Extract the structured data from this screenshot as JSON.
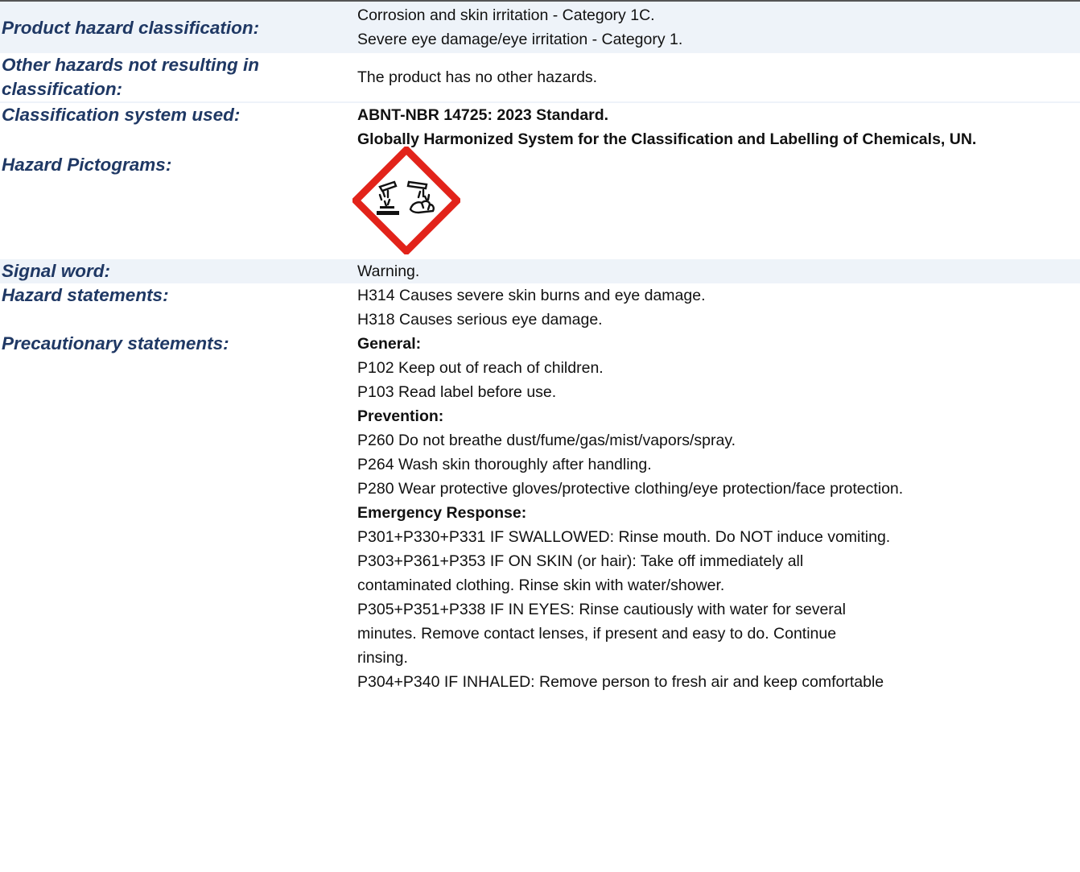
{
  "rows": {
    "product_hazard": {
      "label": "Product hazard classification:",
      "lines": [
        "Corrosion and skin irritation - Category 1C.",
        "Severe eye damage/eye irritation - Category 1."
      ]
    },
    "other_hazards": {
      "label": "Other hazards not resulting in classification:",
      "value": "The product has no other hazards."
    },
    "classification_system": {
      "label": "Classification system used:",
      "line1": "ABNT-NBR 14725: 2023 Standard.",
      "line2": "Globally Harmonized System for the Classification and Labelling of Chemicals, UN."
    },
    "pictograms": {
      "label": "Hazard Pictograms:",
      "icon": "corrosion-pictogram-icon",
      "border_color": "#e2231a"
    },
    "signal_word": {
      "label": "Signal word:",
      "value": "Warning."
    },
    "hazard_statements": {
      "label": "Hazard statements:",
      "lines": [
        "H314 Causes severe skin burns and eye damage.",
        "H318 Causes serious eye damage."
      ]
    },
    "precautionary": {
      "label": "Precautionary statements:",
      "general_heading": "General:",
      "general": [
        "P102 Keep out of reach of children.",
        "P103 Read label before use."
      ],
      "prevention_heading": "Prevention:",
      "prevention": [
        "P260 Do not breathe dust/fume/gas/mist/vapors/spray.",
        "P264 Wash skin thoroughly after handling.",
        "P280 Wear protective gloves/protective clothing/eye protection/face protection."
      ],
      "emergency_heading": "Emergency Response:",
      "emergency": [
        "P301+P330+P331 IF SWALLOWED: Rinse mouth. Do NOT induce vomiting.",
        "P303+P361+P353 IF ON SKIN (or hair): Take off immediately all",
        "contaminated clothing. Rinse skin with water/shower.",
        "P305+P351+P338 IF IN EYES: Rinse cautiously with water for several",
        "minutes. Remove contact lenses, if present and easy to do. Continue",
        "rinsing.",
        "P304+P340 IF INHALED: Remove person to fresh air and keep comfortable"
      ]
    }
  },
  "colors": {
    "label": "#1f3864",
    "row_shade": "#eef3f9",
    "pictogram_red": "#e2231a"
  }
}
